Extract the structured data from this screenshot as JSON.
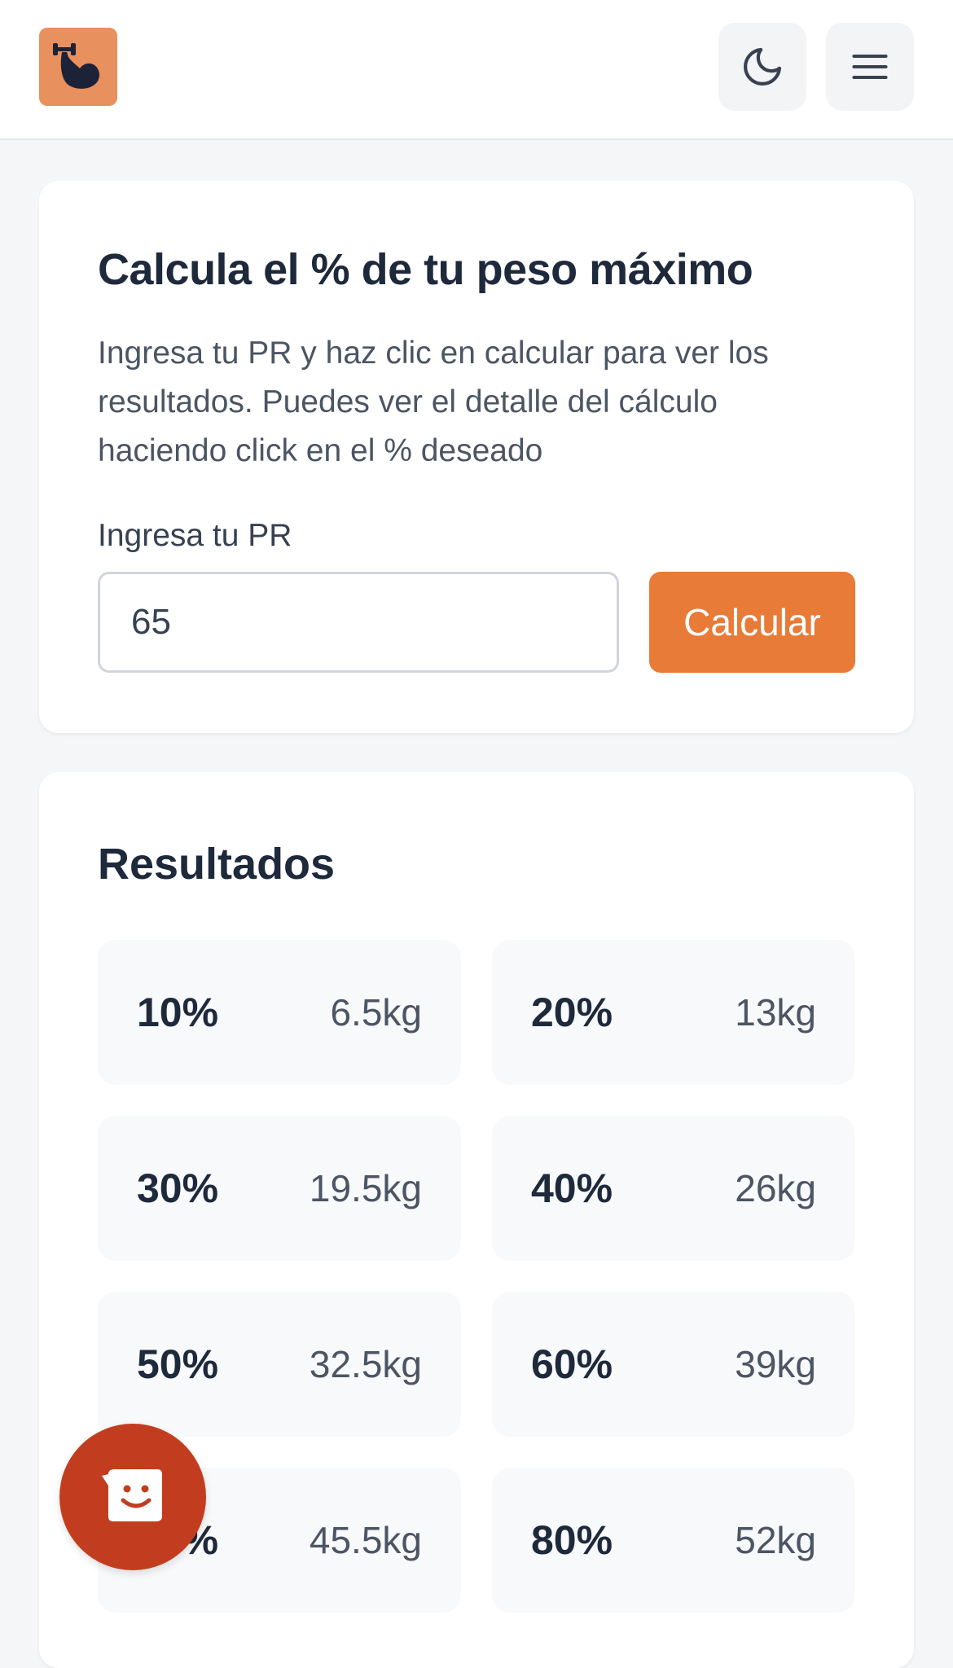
{
  "header": {
    "logo_icon": "flexed-arm-dumbbell-icon",
    "theme_icon": "moon-icon",
    "menu_icon": "hamburger-menu-icon"
  },
  "calculator": {
    "title": "Calcula el % de tu peso máximo",
    "description": "Ingresa tu PR y haz clic en calcular para ver los resultados. Puedes ver el detalle del cálculo haciendo click en el % deseado",
    "input_label": "Ingresa tu PR",
    "input_value": "65",
    "button_label": "Calcular"
  },
  "results": {
    "title": "Resultados",
    "items": [
      {
        "percent": "10%",
        "weight": "6.5kg"
      },
      {
        "percent": "20%",
        "weight": "13kg"
      },
      {
        "percent": "30%",
        "weight": "19.5kg"
      },
      {
        "percent": "40%",
        "weight": "26kg"
      },
      {
        "percent": "50%",
        "weight": "32.5kg"
      },
      {
        "percent": "60%",
        "weight": "39kg"
      },
      {
        "percent": "70%",
        "weight": "45.5kg"
      },
      {
        "percent": "80%",
        "weight": "52kg"
      }
    ]
  },
  "fab": {
    "icon": "smiley-chat-icon"
  },
  "colors": {
    "accent": "#e87b38",
    "logo_bg": "#e8905e",
    "fab_bg": "#c23d1f",
    "text_dark": "#1e293b"
  }
}
